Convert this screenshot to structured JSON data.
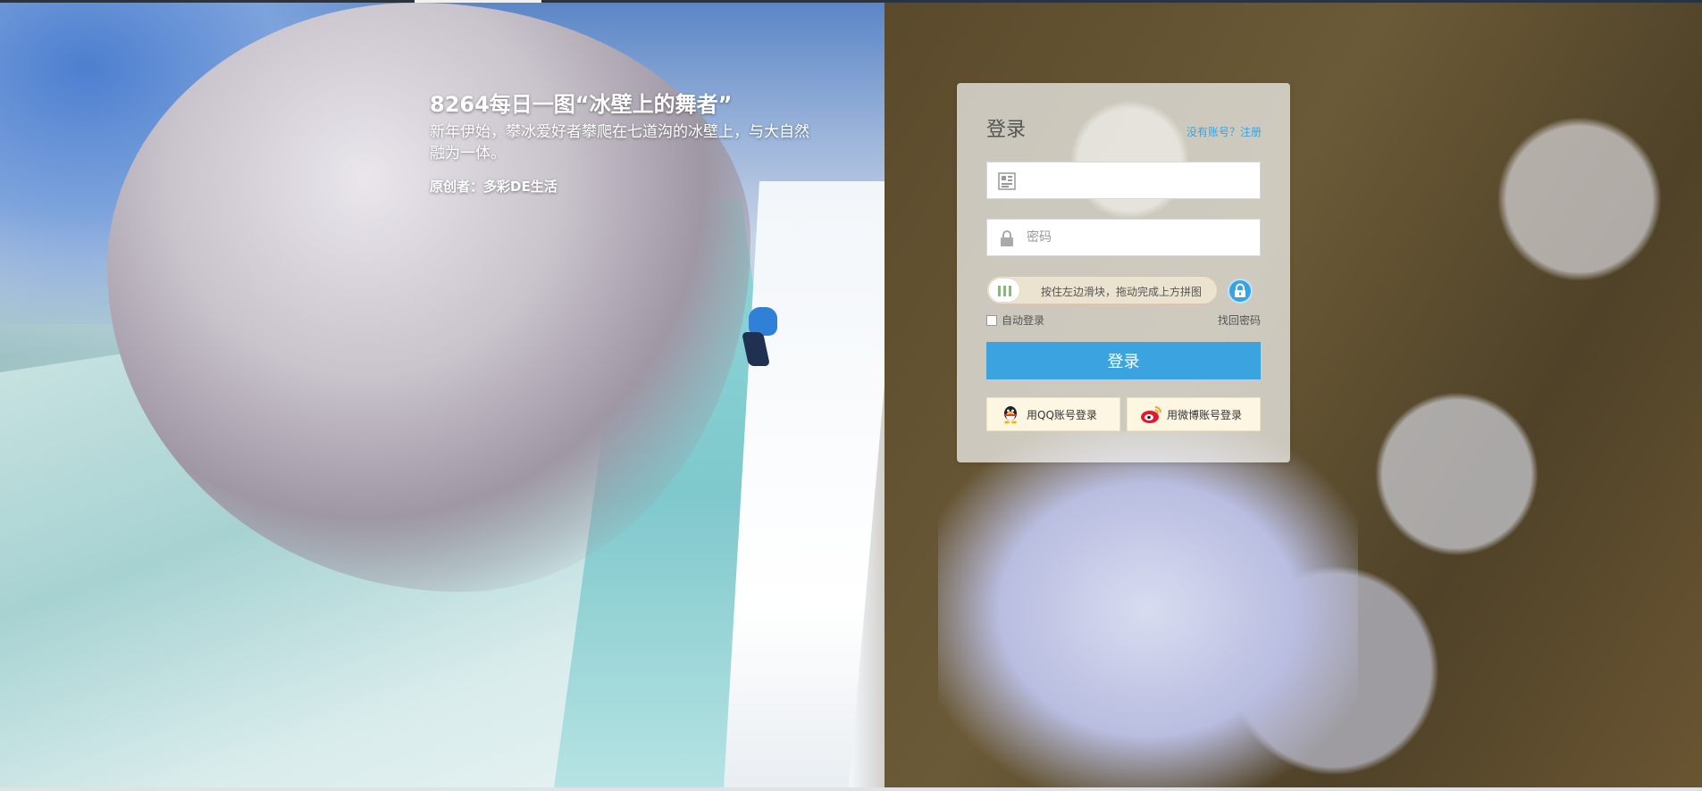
{
  "caption": {
    "title": "8264每日一图“冰壁上的舞者”",
    "description": "新年伊始，攀冰爱好者攀爬在七道沟的冰壁上，与大自然融为一体。",
    "author": "原创者：多彩DE生活"
  },
  "login": {
    "title": "登录",
    "register_link": "没有账号？注册",
    "username_value": "",
    "password_placeholder": "密码",
    "slider_text": "按住左边滑块，拖动完成上方拼图",
    "auto_login_label": "自动登录",
    "forgot_password": "找回密码",
    "submit_label": "登录",
    "qq_login": "用QQ账号登录",
    "weibo_login": "用微博账号登录"
  },
  "colors": {
    "accent": "#3aa3e0",
    "slider_green": "#7cc06a"
  },
  "icons": {
    "username": "qr-user-icon",
    "password": "lock-icon",
    "slider_lock": "lock-icon",
    "qq": "qq-penguin-icon",
    "weibo": "weibo-icon"
  }
}
